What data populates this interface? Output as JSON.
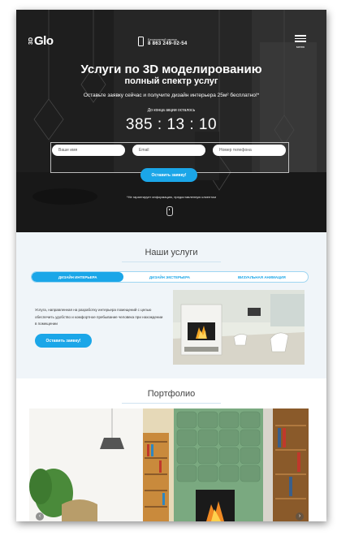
{
  "header": {
    "logo_prefix": "3D",
    "logo_name": "Glo",
    "contact_note": "Бесплатный звонок",
    "phone": "8 863 249-02-54",
    "menu_label": "меню"
  },
  "hero": {
    "title": "Услуги по 3D моделированию",
    "subtitle": "полный спектр услуг",
    "offer": "Оставьте заявку сейчас и получите дизайн интерьера 25м² бесплатно!*",
    "countdown_label": "До конца акции осталось",
    "timer": "385 : 13 : 10",
    "form": {
      "name_placeholder": "Ваше имя",
      "email_placeholder": "Email",
      "phone_placeholder": "Номер телефона",
      "submit_label": "Оставить заявку!"
    },
    "disclaimer": "*Не гарантирует информацию, предоставленную клиентом"
  },
  "services": {
    "title": "Наши услуги",
    "tabs": [
      {
        "label": "ДИЗАЙН ИНТЕРЬЕРА",
        "active": true
      },
      {
        "label": "ДИЗАЙН ЭКСТЕРЬЕРА",
        "active": false
      },
      {
        "label": "ВИЗУАЛЬНАЯ АНИМАЦИЯ",
        "active": false
      }
    ],
    "description": "Услуга, направленная на разработку интерьера помещений с целью обеспечить удобство и комфортное пребывание человека при нахождении в помещении",
    "cta_label": "Оставить заявку!"
  },
  "portfolio": {
    "title": "Портфолио",
    "prev_label": "‹",
    "next_label": "›"
  },
  "colors": {
    "accent": "#1ba6e8",
    "services_bg": "#f0f5f9",
    "wall_green": "#7aa980"
  }
}
